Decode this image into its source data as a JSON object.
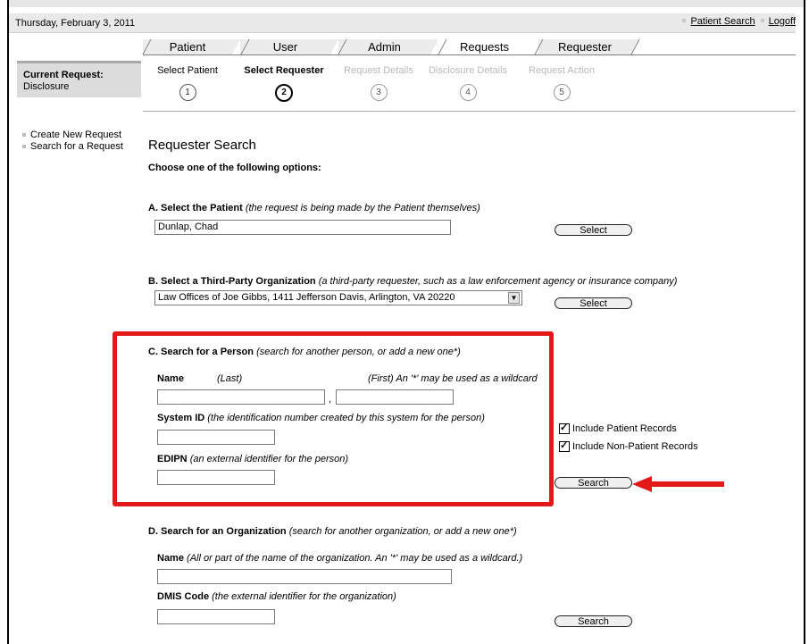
{
  "header": {
    "date": "Thursday, February 3, 2011",
    "patient_search_link": "Patient Search",
    "logoff_link": "Logoff"
  },
  "tabs": [
    {
      "label": "Patient"
    },
    {
      "label": "User"
    },
    {
      "label": "Admin"
    },
    {
      "label": "Requests"
    },
    {
      "label": "Requester"
    }
  ],
  "current_request": {
    "title": "Current Request:",
    "value": "Disclosure"
  },
  "steps": [
    {
      "label": "Select Patient",
      "number": "1"
    },
    {
      "label": "Select Requester",
      "number": "2"
    },
    {
      "label": "Request Details",
      "number": "3"
    },
    {
      "label": "Disclosure Details",
      "number": "4"
    },
    {
      "label": "Request Action",
      "number": "5"
    }
  ],
  "left_nav": [
    {
      "label": "Create New Request"
    },
    {
      "label": "Search for a Request"
    }
  ],
  "page_title": "Requester Search",
  "instructions": "Choose one of the following options:",
  "section_a": {
    "title": "A.  Select the Patient",
    "note": "(the request is being made by the Patient themselves)",
    "value": "Dunlap, Chad",
    "button": "Select"
  },
  "section_b": {
    "title": "B.  Select a Third-Party Organization",
    "note": "(a third-party requester, such as a law enforcement agency or insurance company)",
    "value": "Law Offices of Joe Gibbs, 1411 Jefferson Davis, Arlington, VA 20220",
    "button": "Select"
  },
  "section_c": {
    "title": "C.  Search for a Person",
    "note": "(search for another person, or add a new one*)",
    "name_label": "Name",
    "last_note": "(Last)",
    "first_note": "(First) An '*' may be used as a wildcard",
    "comma": ",",
    "system_id_label": "System ID",
    "system_id_note": "(the identification number created by this system for the person)",
    "edipn_label": "EDIPN",
    "edipn_note": "(an external identifier for the person)",
    "include_patient": "Include Patient Records",
    "include_non_patient": "Include Non-Patient Records",
    "button": "Search"
  },
  "section_d": {
    "title": "D.  Search for an Organization",
    "note": "(search for another organization, or add a new one*)",
    "name_label": "Name",
    "name_note": "(All or part of the name of the organization. An '*' may be used as a wildcard.)",
    "dmis_label": "DMIS Code",
    "dmis_note": "(the external identifier for the organization)",
    "button": "Search"
  },
  "colors": {
    "highlight": "#e31919",
    "header_bg": "#e9e9e9"
  }
}
